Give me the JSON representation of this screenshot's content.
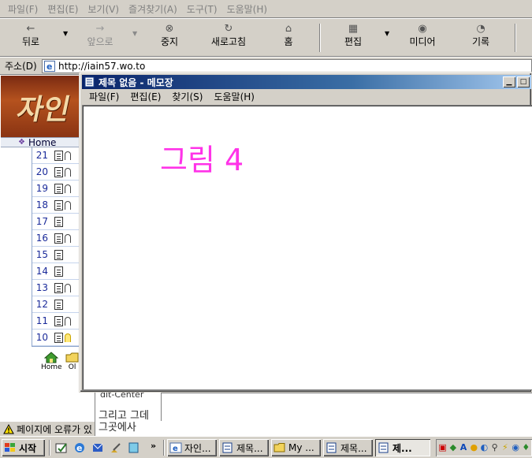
{
  "ie": {
    "menu": [
      "파일(F)",
      "편집(E)",
      "보기(V)",
      "즐겨찾기(A)",
      "도구(T)",
      "도움말(H)"
    ],
    "toolbar": {
      "back": "뒤로",
      "forward": "앞으로",
      "stop": "중지",
      "refresh": "새로고침",
      "home": "홈",
      "edit": "편집",
      "media": "미디어",
      "history": "기록"
    },
    "address": {
      "label": "주소(D)",
      "value": "http://iain57.wo.to"
    },
    "site": {
      "nav_home": "Home",
      "post_numbers": [
        "21",
        "20",
        "19",
        "18",
        "17",
        "16",
        "15",
        "14",
        "13",
        "12",
        "11",
        "10"
      ],
      "home_link": "Home",
      "home_link2": "Ol",
      "sub_text1": "dit-Center",
      "sub_text2": "그리고 그데 그곳에사"
    },
    "status": "페이지에 오류가 있"
  },
  "notepad": {
    "title": "제목 없음 - 메모장",
    "menu": [
      "파일(F)",
      "편집(E)",
      "찾기(S)",
      "도움말(H)"
    ],
    "content": "그림 4",
    "text_color": "#ff33e8"
  },
  "taskbar": {
    "start": "시작",
    "tasks": [
      "자인...",
      "제목...",
      "My ...",
      "제목...",
      "제..."
    ],
    "quicklaunch_more": "»"
  },
  "colors": {
    "titlebar_start": "#0a246a",
    "titlebar_end": "#a6caf0",
    "face": "#d4d0c8"
  }
}
